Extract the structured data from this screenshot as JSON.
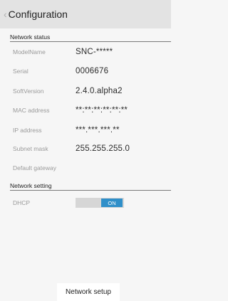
{
  "header": {
    "back_icon": "‹",
    "title": "Configuration"
  },
  "network_status": {
    "heading": "Network status",
    "rows": [
      {
        "label": "ModelName",
        "value": "SNC-*****"
      },
      {
        "label": "Serial",
        "value": "0006676"
      },
      {
        "label": "SoftVersion",
        "value": "2.4.0.alpha2"
      },
      {
        "label": "MAC address",
        "value": "**:**:**:**:**:**"
      },
      {
        "label": "IP address",
        "value": "***.***.***.**"
      },
      {
        "label": "Subnet mask",
        "value": "255.255.255.0"
      },
      {
        "label": "Default gateway",
        "value": ""
      }
    ]
  },
  "network_setting": {
    "heading": "Network setting",
    "dhcp_label": "DHCP",
    "dhcp_state": "ON"
  },
  "footer": {
    "button_label": "Network setup"
  },
  "colors": {
    "accent": "#2f8fc9",
    "header_bg": "#e3e3e3",
    "page_bg": "#f6f6f6"
  }
}
